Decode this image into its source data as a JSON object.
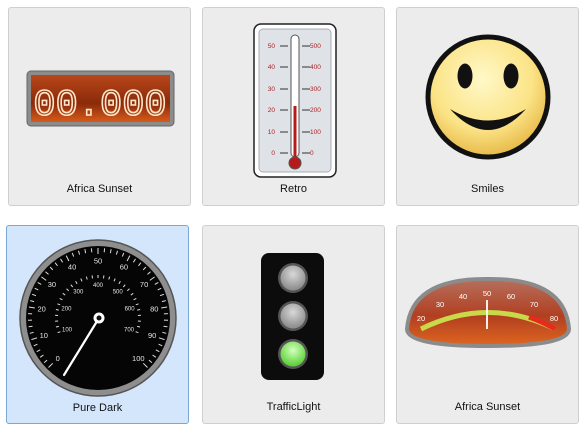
{
  "gallery": {
    "tiles": [
      {
        "label": "Africa Sunset",
        "icon": "digital-counter-icon"
      },
      {
        "label": "Retro",
        "icon": "thermometer-icon"
      },
      {
        "label": "Smiles",
        "icon": "smiley-icon"
      },
      {
        "label": "Pure Dark",
        "icon": "speedometer-icon"
      },
      {
        "label": "TrafficLight",
        "icon": "traffic-light-icon"
      },
      {
        "label": "Africa Sunset",
        "icon": "arc-gauge-icon"
      }
    ],
    "selected_index": 3
  },
  "counter": {
    "digits": "00.000"
  },
  "thermometer": {
    "left_scale": [
      "50",
      "40",
      "30",
      "20",
      "10",
      "0"
    ],
    "right_scale": [
      "500",
      "400",
      "300",
      "200",
      "100",
      "0"
    ]
  },
  "speedometer": {
    "outer_scale": [
      "0",
      "10",
      "20",
      "30",
      "40",
      "50",
      "60",
      "70",
      "80",
      "90",
      "100"
    ],
    "inner_scale": [
      "100",
      "200",
      "300",
      "400",
      "500",
      "600",
      "700"
    ]
  },
  "arc_gauge": {
    "scale": [
      "20",
      "30",
      "40",
      "50",
      "60",
      "70",
      "80"
    ]
  },
  "colors": {
    "tile_bg": "#ececec",
    "selected_bg": "#d3e6fb",
    "sunset_red": "#c0392b",
    "light_green": "#7ddc4a"
  }
}
